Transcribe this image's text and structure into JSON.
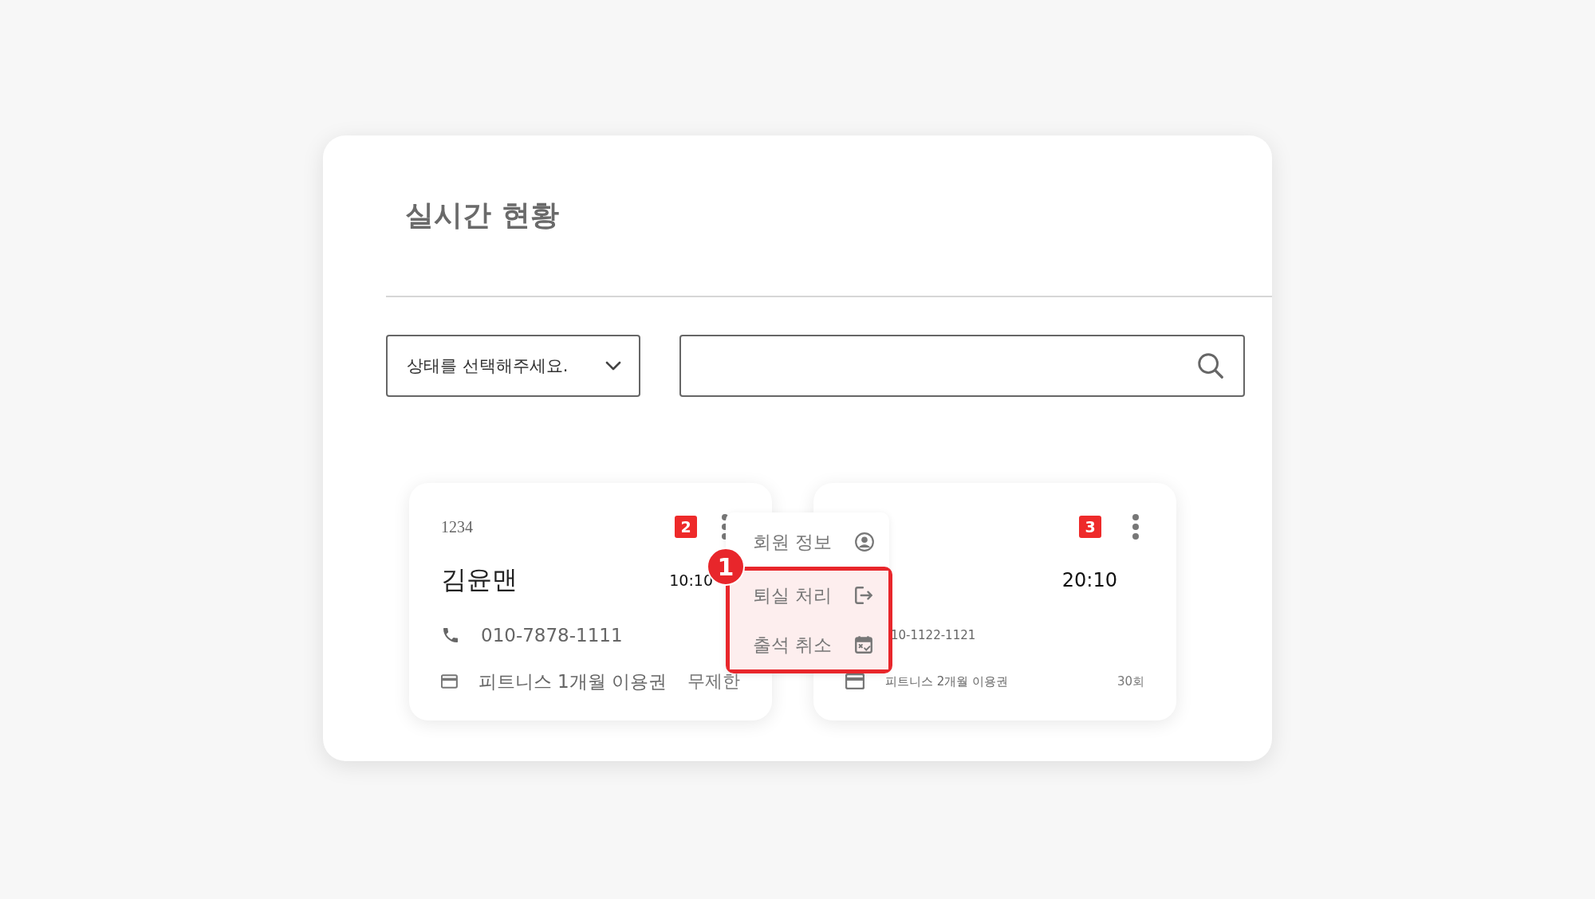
{
  "title": "실시간 현황",
  "status_select": {
    "placeholder": "상태를 선택해주세요."
  },
  "cards": [
    {
      "id": "1234",
      "badge": "2",
      "name": "김윤맨",
      "time": "10:10",
      "phone": "010-7878-1111",
      "ticket": "피트니스 1개월 이용권",
      "count": "무제한"
    },
    {
      "badge": "3",
      "time": "20:10",
      "phone": "10-1122-1121",
      "ticket": "피트니스 2개월 이용권",
      "count": "30회"
    }
  ],
  "menu": {
    "items": [
      {
        "label": "회원 정보",
        "highlighted": false
      },
      {
        "label": "퇴실 처리",
        "highlighted": true
      },
      {
        "label": "출석 취소",
        "highlighted": true
      }
    ]
  },
  "step_marker": "1"
}
